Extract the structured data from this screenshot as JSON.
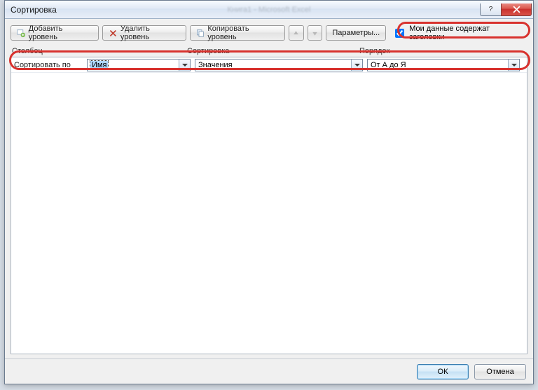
{
  "title": "Сортировка",
  "ghost_app": "Книга1 - Microsoft Excel",
  "toolbar": {
    "add": "Добавить уровень",
    "delete": "Удалить уровень",
    "copy": "Копировать уровень",
    "options": "Параметры..."
  },
  "checkbox": {
    "label": "Мои данные содержат заголовки",
    "checked": true
  },
  "headers": {
    "col1": "Столбец",
    "col2": "Сортировка",
    "col3": "Порядок"
  },
  "row": {
    "label": "Сортировать по",
    "column_value": "Имя",
    "sort_on_value": "Значения",
    "order_value": "От А до Я"
  },
  "footer": {
    "ok": "ОК",
    "cancel": "Отмена"
  }
}
